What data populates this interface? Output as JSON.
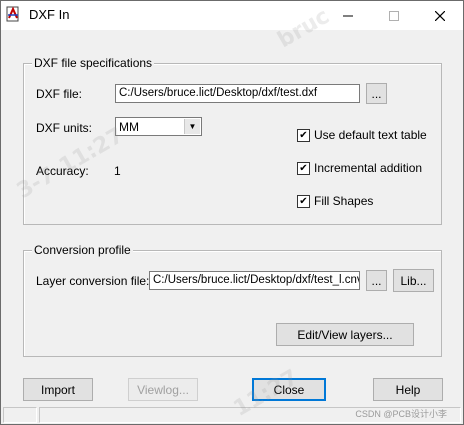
{
  "window": {
    "title": "DXF In"
  },
  "spec_group": {
    "title": "DXF file specifications",
    "dxf_file_label": "DXF file:",
    "dxf_file_value": "C:/Users/bruce.lict/Desktop/dxf/test.dxf",
    "browse_label": "...",
    "dxf_units_label": "DXF units:",
    "dxf_units_value": "MM",
    "accuracy_label": "Accuracy:",
    "accuracy_value": "1",
    "options": [
      {
        "label": "Use default text table",
        "checked": true
      },
      {
        "label": "Incremental addition",
        "checked": true
      },
      {
        "label": "Fill Shapes",
        "checked": true
      }
    ]
  },
  "conversion_group": {
    "title": "Conversion profile",
    "layer_file_label": "Layer conversion file:",
    "layer_file_value": "C:/Users/bruce.lict/Desktop/dxf/test_l.cnv",
    "browse_label": "...",
    "lib_label": "Lib...",
    "edit_layers_label": "Edit/View layers..."
  },
  "buttons": {
    "import": "Import",
    "viewlog": "Viewlog...",
    "close": "Close",
    "help": "Help"
  },
  "watermarks": {
    "mark1": "bruc",
    "mark2": "3-7-11:27",
    "mark3": "11:27"
  },
  "credit": "CSDN @PCB设计小李"
}
